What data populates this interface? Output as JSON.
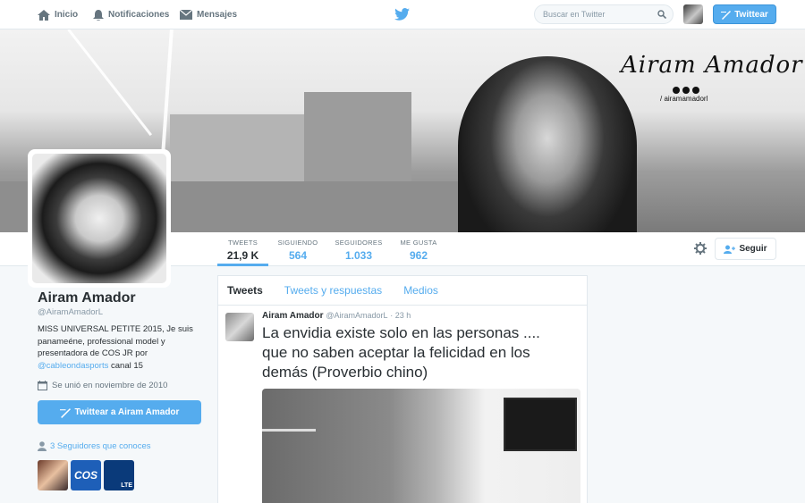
{
  "nav": {
    "home": "Inicio",
    "notifications": "Notificaciones",
    "messages": "Mensajes",
    "search_placeholder": "Buscar en Twitter",
    "tweet_button": "Twittear"
  },
  "banner": {
    "brand_text": "Airam Amador",
    "brand_handle": "/ airamamadorl"
  },
  "profile_nav": {
    "stats": [
      {
        "label": "TWEETS",
        "value": "21,9 K"
      },
      {
        "label": "SIGUIENDO",
        "value": "564"
      },
      {
        "label": "SEGUIDORES",
        "value": "1.033"
      },
      {
        "label": "ME GUSTA",
        "value": "962"
      }
    ],
    "follow_label": "Seguir"
  },
  "profile": {
    "name": "Airam Amador",
    "handle": "@AiramAmadorL",
    "bio_text": "MISS UNIVERSAL PETITE 2015, Je suis panameéne, professional model y presentadora de COS JR por",
    "bio_link": "@cableondasports",
    "bio_suffix": " canal 15",
    "joined": "Se unió en noviembre de 2010",
    "tweet_to_label": "Twittear a Airam Amador",
    "followers_you_know": "3 Seguidores que conoces",
    "known_thumbs": [
      {
        "label": ""
      },
      {
        "label": "COS"
      },
      {
        "label": "LTE"
      }
    ]
  },
  "timeline": {
    "tabs": [
      "Tweets",
      "Tweets y respuestas",
      "Medios"
    ],
    "tweet": {
      "name": "Airam Amador",
      "handle": "@AiramAmadorL",
      "time": "· 23 h",
      "text": "La envidia existe solo en las personas .... que no saben aceptar la felicidad en los demás (Proverbio chino)"
    }
  },
  "colors": {
    "accent": "#55acee",
    "text": "#292f33",
    "muted": "#8899a6",
    "background": "#f5f8fa"
  }
}
